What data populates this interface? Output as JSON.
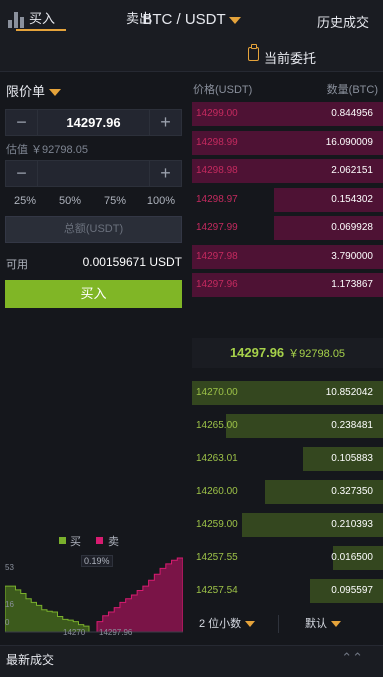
{
  "header": {
    "pair": "BTC / USDT",
    "history_link": "历史成交"
  },
  "tabs": {
    "buy": "买入",
    "sell": "卖出",
    "orders": "当前委托"
  },
  "form": {
    "order_type": "限价单",
    "price_value": "14297.96",
    "estimate": "估值 ￥92798.05",
    "amount_value": "",
    "percents": [
      "25%",
      "50%",
      "75%",
      "100%"
    ],
    "total_placeholder": "总额(USDT)",
    "available_label": "可用",
    "available_value": "0.00159671 USDT",
    "buy_button": "买入",
    "minus_symbol": "−",
    "plus_symbol": "+"
  },
  "depth": {
    "legend_buy": "买",
    "legend_sell": "卖",
    "spread_pct": "0.19%",
    "y_labels": [
      "53",
      "16",
      "0"
    ],
    "x_labels": [
      "14270",
      "14297.96"
    ],
    "colors": {
      "buy": "#7ab02c",
      "sell": "#d81b70"
    },
    "bid_levels": [
      0.62,
      0.62,
      0.57,
      0.52,
      0.45,
      0.4,
      0.36,
      0.3,
      0.28,
      0.27,
      0.21,
      0.17,
      0.16,
      0.14,
      0.1,
      0.08
    ],
    "ask_levels": [
      0.14,
      0.22,
      0.27,
      0.33,
      0.4,
      0.45,
      0.5,
      0.56,
      0.62,
      0.7,
      0.78,
      0.86,
      0.92,
      0.97,
      1.0
    ]
  },
  "book": {
    "header_price": "价格(USDT)",
    "header_amount": "数量(BTC)",
    "asks": [
      {
        "price": "14299.00",
        "amount": "0.844956",
        "depth": 1.0
      },
      {
        "price": "14298.99",
        "amount": "16.090009",
        "depth": 1.0
      },
      {
        "price": "14298.98",
        "amount": "2.062151",
        "depth": 1.0
      },
      {
        "price": "14298.97",
        "amount": "0.154302",
        "depth": 0.57
      },
      {
        "price": "14297.99",
        "amount": "0.069928",
        "depth": 0.57
      },
      {
        "price": "14297.98",
        "amount": "3.790000",
        "depth": 1.0
      },
      {
        "price": "14297.96",
        "amount": "1.173867",
        "depth": 1.0
      }
    ],
    "mid_price": "14297.96",
    "mid_cny": "￥92798.05",
    "bids": [
      {
        "price": "14270.00",
        "amount": "10.852042",
        "depth": 1.0
      },
      {
        "price": "14265.00",
        "amount": "0.238481",
        "depth": 0.82
      },
      {
        "price": "14263.01",
        "amount": "0.105883",
        "depth": 0.42
      },
      {
        "price": "14260.00",
        "amount": "0.327350",
        "depth": 0.62
      },
      {
        "price": "14259.00",
        "amount": "0.210393",
        "depth": 0.74
      },
      {
        "price": "14257.55",
        "amount": "0.016500",
        "depth": 0.26
      },
      {
        "price": "14257.54",
        "amount": "0.095597",
        "depth": 0.38
      }
    ],
    "decimals_select": "2 位小数",
    "default_select": "默认"
  },
  "bottom": {
    "latest_trades": "最新成交",
    "collapse_symbol": "⌃⌃"
  }
}
